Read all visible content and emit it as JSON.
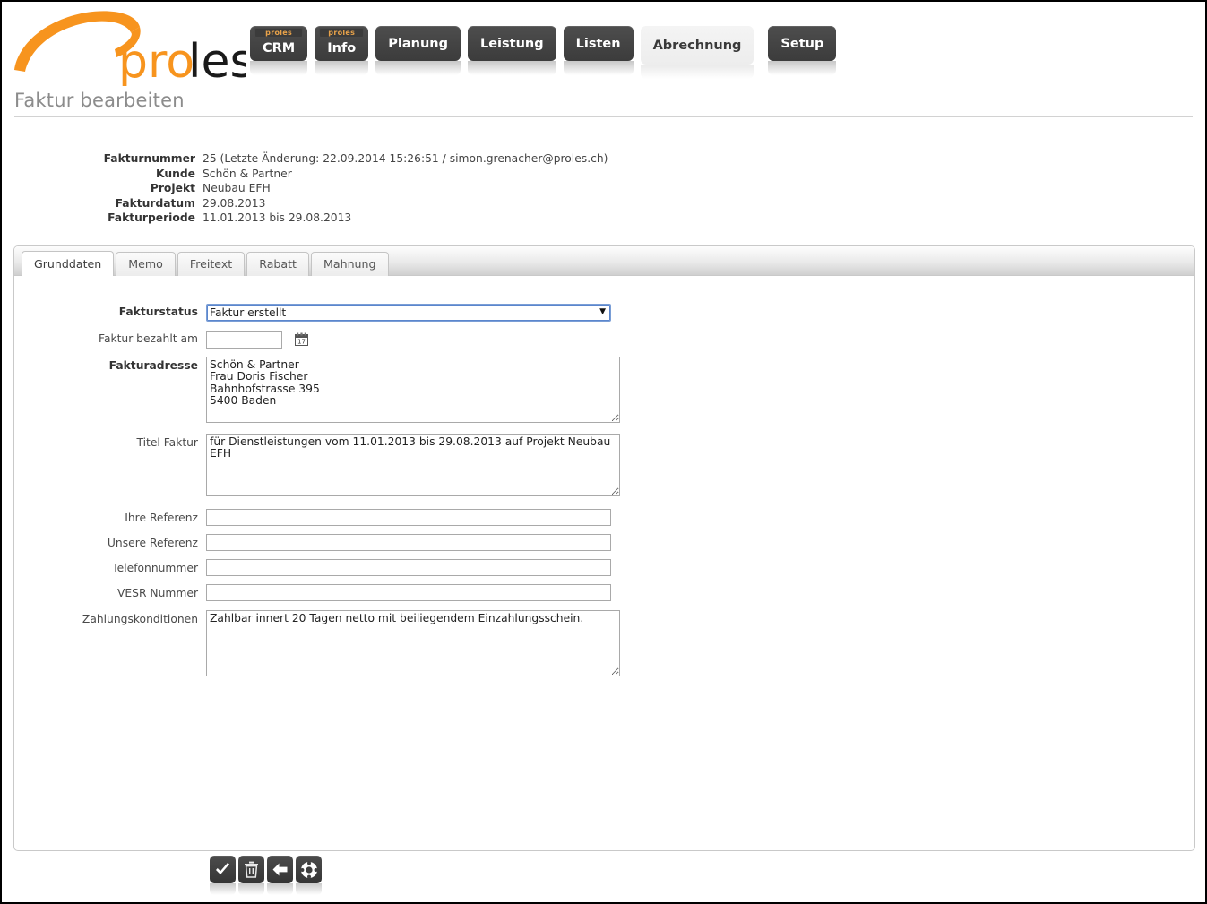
{
  "app": {
    "logo_text_primary": "pro",
    "logo_text_secondary": "les",
    "page_title": "Faktur bearbeiten"
  },
  "nav": {
    "items": [
      {
        "label": "CRM",
        "pill": "proles",
        "active": false
      },
      {
        "label": "Info",
        "pill": "proles",
        "active": false
      },
      {
        "label": "Planung",
        "pill": "",
        "active": false
      },
      {
        "label": "Leistung",
        "pill": "",
        "active": false
      },
      {
        "label": "Listen",
        "pill": "",
        "active": false
      },
      {
        "label": "Abrechnung",
        "pill": "",
        "active": true
      },
      {
        "label": "Setup",
        "pill": "",
        "active": false
      }
    ]
  },
  "meta": {
    "rows": [
      {
        "label": "Fakturnummer",
        "value": "25 (Letzte Änderung: 22.09.2014 15:26:51 / simon.grenacher@proles.ch)"
      },
      {
        "label": "Kunde",
        "value": "Schön & Partner"
      },
      {
        "label": "Projekt",
        "value": "Neubau EFH"
      },
      {
        "label": "Fakturdatum",
        "value": "29.08.2013"
      },
      {
        "label": "Fakturperiode",
        "value": "11.01.2013 bis 29.08.2013"
      }
    ]
  },
  "tabs": [
    {
      "label": "Grunddaten",
      "active": true
    },
    {
      "label": "Memo",
      "active": false
    },
    {
      "label": "Freitext",
      "active": false
    },
    {
      "label": "Rabatt",
      "active": false
    },
    {
      "label": "Mahnung",
      "active": false
    }
  ],
  "form": {
    "fakturstatus": {
      "label": "Fakturstatus",
      "value": "Faktur erstellt",
      "options": [
        "Faktur erstellt"
      ]
    },
    "bezahlt_am": {
      "label": "Faktur bezahlt am",
      "value": "",
      "placeholder": "",
      "icon": "calendar-icon",
      "icon_day": "17"
    },
    "fakturadresse": {
      "label": "Fakturadresse",
      "value": "Schön & Partner\nFrau Doris Fischer\nBahnhofstrasse 395\n5400 Baden"
    },
    "titel_faktur": {
      "label": "Titel Faktur",
      "value": "für Dienstleistungen vom 11.01.2013 bis 29.08.2013 auf Projekt Neubau EFH"
    },
    "ihre_referenz": {
      "label": "Ihre Referenz",
      "value": ""
    },
    "unsere_referenz": {
      "label": "Unsere Referenz",
      "value": ""
    },
    "telefonnummer": {
      "label": "Telefonnummer",
      "value": ""
    },
    "vesr_nummer": {
      "label": "VESR Nummer",
      "value": ""
    },
    "zahlungskonditionen": {
      "label": "Zahlungskonditionen",
      "value": "Zahlbar innert 20 Tagen netto mit beiliegendem Einzahlungsschein."
    }
  },
  "toolbar": {
    "save": "save-check-icon",
    "delete": "trash-icon",
    "back": "back-arrow-icon",
    "help": "lifebuoy-help-icon"
  },
  "colors": {
    "brand_orange": "#F7941E",
    "nav_dark": "#444444",
    "focus_blue": "#5B86CD",
    "title_grey": "#8C8C8C"
  }
}
